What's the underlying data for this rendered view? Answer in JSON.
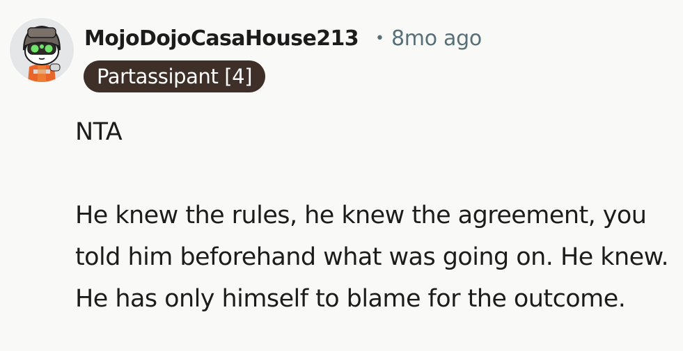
{
  "comment": {
    "author": "MojoDojoCasaHouse213",
    "separator": "•",
    "timestamp": "8mo ago",
    "flair": "Partassipant [4]",
    "avatar_icon": "snoo-avatar-icon",
    "paragraphs": [
      "NTA",
      "He knew the rules, he knew the agreement, you told him beforehand what was going on. He knew. He has only himself to blame for the outcome."
    ]
  },
  "colors": {
    "background": "#f9f9f8",
    "text": "#1c1c1c",
    "meta": "#576f76",
    "flair_bg": "#3f2f29",
    "flair_text": "#ffffff"
  }
}
